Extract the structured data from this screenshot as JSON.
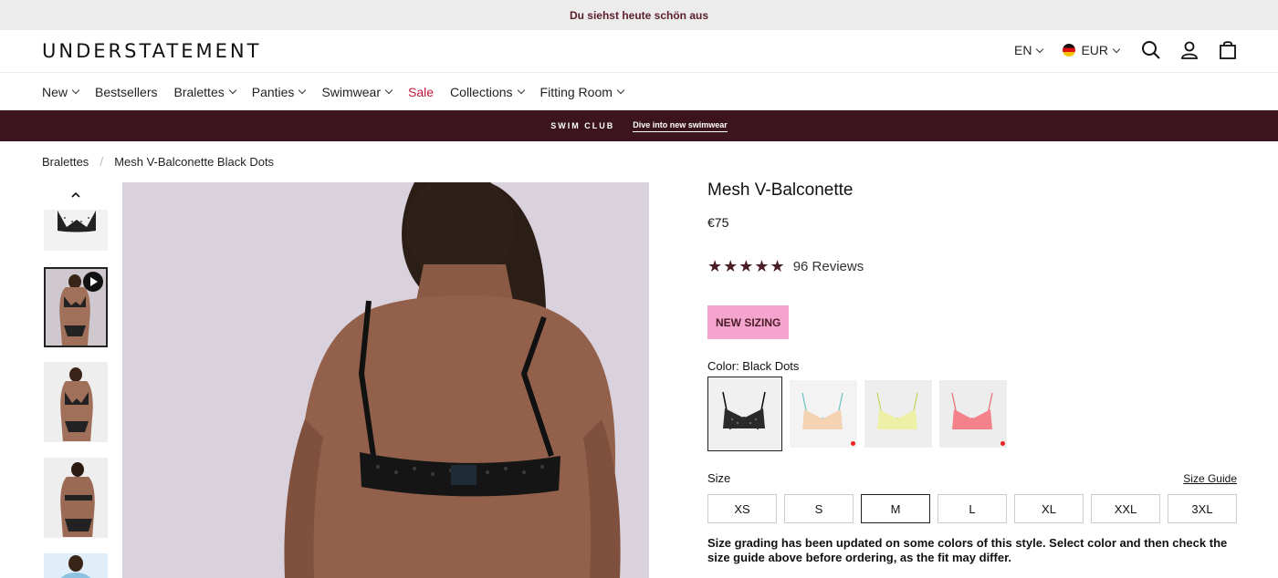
{
  "announcement": "Du siehst heute schön aus",
  "header": {
    "logo": "UNDERSTATEMENT",
    "language": "EN",
    "currency": "EUR",
    "icons": [
      "search-icon",
      "account-icon",
      "bag-icon"
    ]
  },
  "nav": {
    "items": [
      {
        "label": "New",
        "dropdown": true
      },
      {
        "label": "Bestsellers",
        "dropdown": false
      },
      {
        "label": "Bralettes",
        "dropdown": true
      },
      {
        "label": "Panties",
        "dropdown": true
      },
      {
        "label": "Swimwear",
        "dropdown": true
      },
      {
        "label": "Sale",
        "dropdown": false
      },
      {
        "label": "Collections",
        "dropdown": true
      },
      {
        "label": "Fitting Room",
        "dropdown": true
      }
    ]
  },
  "promo": {
    "left": "SWIM CLUB",
    "link": "Dive into new swimwear"
  },
  "breadcrumb": {
    "parent": "Bralettes",
    "separator": "/",
    "current": "Mesh V-Balconette Black Dots"
  },
  "product": {
    "title": "Mesh V-Balconette",
    "price": "€75",
    "stars": "★★★★★",
    "reviews": "96 Reviews",
    "badge": "NEW SIZING",
    "color_label": "Color: Black Dots",
    "size_label": "Size",
    "size_guide": "Size Guide",
    "sizes": [
      "XS",
      "S",
      "M",
      "L",
      "XL",
      "XXL",
      "3XL"
    ],
    "selected_size": "M",
    "note": "Size grading has been updated on some colors of this style. Select color and then check the size guide above before ordering, as the fit may differ."
  },
  "colors": {
    "accent": "#4b1d27",
    "sale": "#c4173c",
    "badge_bg": "#f5a4cf",
    "promo_bg": "#3b141e"
  }
}
